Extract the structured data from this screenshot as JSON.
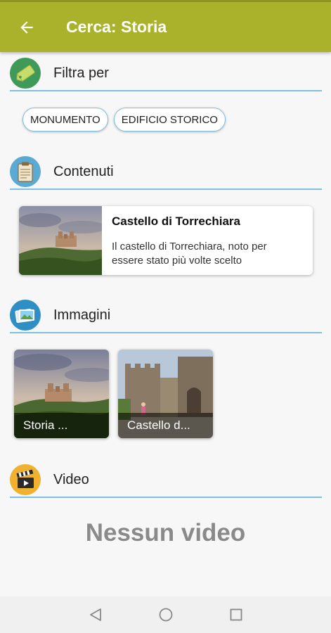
{
  "appbar": {
    "title": "Cerca: Storia",
    "color": "#a9b22a"
  },
  "filter": {
    "title": "Filtra per",
    "chips": [
      "MONUMENTO",
      "EDIFICIO STORICO"
    ]
  },
  "contents": {
    "title": "Contenuti",
    "items": [
      {
        "title": "Castello di Torrechiara",
        "description": "Il castello di Torrechiara, noto per essere stato più volte scelto"
      }
    ]
  },
  "images": {
    "title": "Immagini",
    "items": [
      {
        "label": "Storia ..."
      },
      {
        "label": "Castello d..."
      }
    ]
  },
  "video": {
    "title": "Video",
    "empty_text": "Nessun video"
  },
  "icons": {
    "back": "arrow-back-icon",
    "filter": "tag-icon",
    "contents": "clipboard-icon",
    "images": "photos-icon",
    "video": "clapperboard-icon",
    "nav": [
      "back-triangle-icon",
      "home-circle-icon",
      "recents-square-icon"
    ]
  }
}
